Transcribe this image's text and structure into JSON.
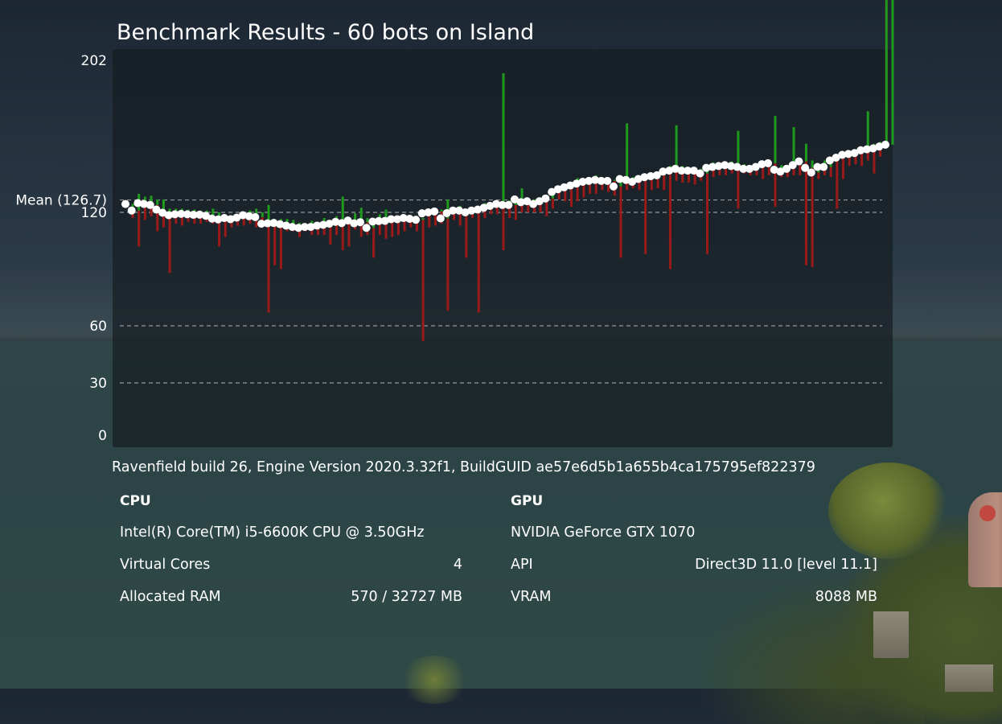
{
  "title": "Benchmark Results - 60 bots on Island",
  "build_info": "Ravenfield build 26, Engine Version 2020.3.32f1, BuildGUID ae57e6d5b1a655b4ca175795ef822379",
  "cpu": {
    "heading": "CPU",
    "name": "Intel(R) Core(TM) i5-6600K CPU @ 3.50GHz",
    "virtual_cores_label": "Virtual Cores",
    "virtual_cores_value": "4",
    "ram_label": "Allocated RAM",
    "ram_value": "570 / 32727 MB"
  },
  "gpu": {
    "heading": "GPU",
    "name": "NVIDIA GeForce GTX 1070",
    "api_label": "API",
    "api_value": "Direct3D 11.0 [level 11.1]",
    "vram_label": "VRAM",
    "vram_value": "8088 MB"
  },
  "colors": {
    "mean_point": "#ffffff",
    "max_bar": "#1e9a1e",
    "min_bar": "#9a1a1a",
    "gridline": "#b4b4b4"
  },
  "chart_data": {
    "type": "line",
    "title": "Benchmark Results - 60 bots on Island",
    "y_ticks": [
      0,
      30,
      60,
      120,
      202
    ],
    "y_tick_labels": [
      "0",
      "30",
      "60",
      "120",
      "202"
    ],
    "ylim": [
      0,
      202
    ],
    "mean_value": 126.7,
    "mean_label": "Mean (126.7)",
    "gridlines_at": [
      30,
      60,
      120,
      126.7
    ],
    "series": [
      {
        "values": [
          124.5,
          121.0,
          125.0,
          124.5,
          124.0,
          121.5,
          119.8,
          118.5,
          119.0,
          119.2,
          119.0,
          118.7,
          118.8,
          118.2,
          116.7,
          116.3,
          117.0,
          116.4,
          117.2,
          118.5,
          118.0,
          117.5,
          114.0,
          114.2,
          114.4,
          113.8,
          113.0,
          112.3,
          111.8,
          112.3,
          112.3,
          113.0,
          113.4,
          114.0,
          115.0,
          114.3,
          115.7,
          114.2,
          114.8,
          111.8,
          115.1,
          115.4,
          115.5,
          116.4,
          116.4,
          117.0,
          116.6,
          116.1,
          119.5,
          120.0,
          120.5,
          116.8,
          119.6,
          121.0,
          121.0,
          120.0,
          121.0,
          121.5,
          122.5,
          123.5,
          124.5,
          124.0,
          124.0,
          127.0,
          125.5,
          126.0,
          124.5,
          126.0,
          127.5,
          131.0,
          132.5,
          133.5,
          134.5,
          135.5,
          136.5,
          137.0,
          137.5,
          137.0,
          137.0,
          134.0,
          138.0,
          137.5,
          136.5,
          138.0,
          139.0,
          139.5,
          140.0,
          142.0,
          142.5,
          143.5,
          142.5,
          142.5,
          142.5,
          141.0,
          144.0,
          144.5,
          145.0,
          145.5,
          145.0,
          144.5,
          143.5,
          143.5,
          144.5,
          146.0,
          146.5,
          143.0,
          142.0,
          143.5,
          145.5,
          147.5,
          144.0,
          141.5,
          144.5,
          144.5,
          148.0,
          149.5,
          151.0,
          151.5,
          152.0,
          153.5,
          154.0,
          154.5,
          155.5,
          156.5
        ]
      },
      {
        "values": [
          122.0,
          130.0,
          128.5,
          129.0,
          127.0,
          127.0,
          122.0,
          122.0,
          122.0,
          121.5,
          121.5,
          121.0,
          121.0,
          122.0,
          120.0,
          117.5,
          118.5,
          118.5,
          120.0,
          121.0,
          122.0,
          120.0,
          124.0,
          116.5,
          116.5,
          116.5,
          116.0,
          114.5,
          113.8,
          115.5,
          115.0,
          117.0,
          115.5,
          118.0,
          128.5,
          117.0,
          119.5,
          122.5,
          117.0,
          114.0,
          119.0,
          121.5,
          117.0,
          117.0,
          117.0,
          118.0,
          118.0,
          117.0,
          122.0,
          122.0,
          121.5,
          127.0,
          122.0,
          123.5,
          122.0,
          121.5,
          121.5,
          125.0,
          124.0,
          126.0,
          195.0,
          126.5,
          126.0,
          133.0,
          127.0,
          127.0,
          128.0,
          129.0,
          130.0,
          132.5,
          133.0,
          135.0,
          138.5,
          136.5,
          138.0,
          140.0,
          139.0,
          138.0,
          137.5,
          139.5,
          168.0,
          139.0,
          139.0,
          140.5,
          141.5,
          142.0,
          142.0,
          145.0,
          167.0,
          145.0,
          143.5,
          144.5,
          143.5,
          142.5,
          147.0,
          145.0,
          147.0,
          147.5,
          164.0,
          146.0,
          145.0,
          145.0,
          147.0,
          148.0,
          172.0,
          145.5,
          145.5,
          166.0,
          147.5,
          157.0,
          148.0,
          144.0,
          148.0,
          146.0,
          150.0,
          152.0,
          153.0,
          153.0,
          155.0,
          174.5,
          157.0,
          158.0
        ]
      },
      {
        "values": [
          117.0,
          102.0,
          116.0,
          118.0,
          110.0,
          112.0,
          88.0,
          114.0,
          113.0,
          115.0,
          114.0,
          114.0,
          115.0,
          114.0,
          102.0,
          107.0,
          112.0,
          113.0,
          113.0,
          114.0,
          112.0,
          112.0,
          67.0,
          92.0,
          90.0,
          110.0,
          110.0,
          107.0,
          110.0,
          108.0,
          108.0,
          108.0,
          103.0,
          108.0,
          100.0,
          102.0,
          111.0,
          107.0,
          108.0,
          96.0,
          108.0,
          106.0,
          107.0,
          108.0,
          110.0,
          112.0,
          110.0,
          52.0,
          112.0,
          113.0,
          114.0,
          68.0,
          116.0,
          113.0,
          96.0,
          117.0,
          67.0,
          117.0,
          119.0,
          119.0,
          100.0,
          117.0,
          116.0,
          120.0,
          120.0,
          120.0,
          120.0,
          118.0,
          122.0,
          127.0,
          126.0,
          123.0,
          126.0,
          128.0,
          130.0,
          130.0,
          132.0,
          131.0,
          129.0,
          96.0,
          132.0,
          133.0,
          132.0,
          98.0,
          132.0,
          133.0,
          132.0,
          90.0,
          137.0,
          136.0,
          136.0,
          135.0,
          137.0,
          98.0,
          139.0,
          140.0,
          140.0,
          141.0,
          122.0,
          141.0,
          140.0,
          140.0,
          138.0,
          140.0,
          123.0,
          139.0,
          139.0,
          140.0,
          140.0,
          92.0,
          91.0,
          138.0,
          140.0,
          139.0,
          122.0,
          138.0,
          145.0,
          146.0,
          145.0,
          148.0,
          141.0,
          150.0
        ]
      }
    ]
  }
}
